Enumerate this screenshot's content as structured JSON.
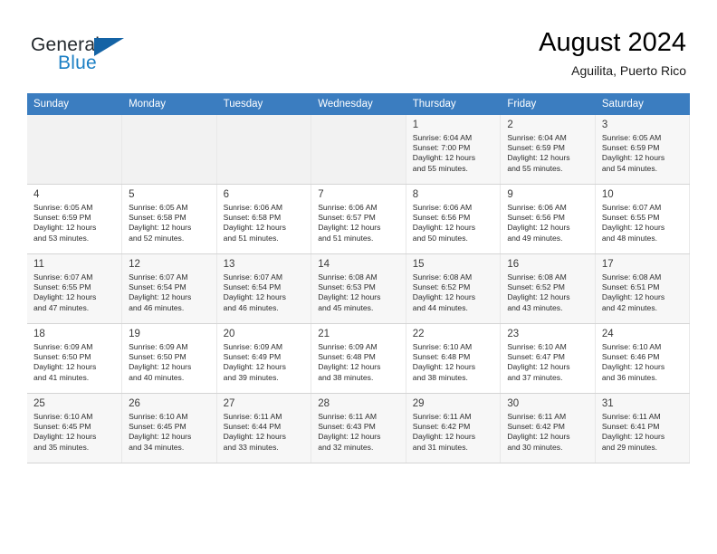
{
  "brand": {
    "name_part1": "General",
    "name_part2": "Blue",
    "flag_icon": "blue-triangle-flag-icon"
  },
  "header": {
    "title": "August 2024",
    "subtitle": "Aguilita, Puerto Rico"
  },
  "colors": {
    "header_row_bg": "#3b7dc0",
    "header_row_text": "#ffffff",
    "brand_blue": "#1b7fc4",
    "empty_cell_bg": "#f2f2f2",
    "shade_row_bg": "#f7f7f7",
    "grid_line": "#d4d4d4"
  },
  "labels": {
    "sunrise_prefix": "Sunrise:",
    "sunset_prefix": "Sunset:",
    "daylight_prefix": "Daylight:"
  },
  "weekday_headers": [
    "Sunday",
    "Monday",
    "Tuesday",
    "Wednesday",
    "Thursday",
    "Friday",
    "Saturday"
  ],
  "weeks": [
    [
      {
        "empty": true
      },
      {
        "empty": true
      },
      {
        "empty": true
      },
      {
        "empty": true
      },
      {
        "day": "1",
        "sunrise": "Sunrise: 6:04 AM",
        "sunset": "Sunset: 7:00 PM",
        "daylight_line1": "Daylight: 12 hours",
        "daylight_line2": "and 55 minutes."
      },
      {
        "day": "2",
        "sunrise": "Sunrise: 6:04 AM",
        "sunset": "Sunset: 6:59 PM",
        "daylight_line1": "Daylight: 12 hours",
        "daylight_line2": "and 55 minutes."
      },
      {
        "day": "3",
        "sunrise": "Sunrise: 6:05 AM",
        "sunset": "Sunset: 6:59 PM",
        "daylight_line1": "Daylight: 12 hours",
        "daylight_line2": "and 54 minutes."
      }
    ],
    [
      {
        "day": "4",
        "sunrise": "Sunrise: 6:05 AM",
        "sunset": "Sunset: 6:59 PM",
        "daylight_line1": "Daylight: 12 hours",
        "daylight_line2": "and 53 minutes."
      },
      {
        "day": "5",
        "sunrise": "Sunrise: 6:05 AM",
        "sunset": "Sunset: 6:58 PM",
        "daylight_line1": "Daylight: 12 hours",
        "daylight_line2": "and 52 minutes."
      },
      {
        "day": "6",
        "sunrise": "Sunrise: 6:06 AM",
        "sunset": "Sunset: 6:58 PM",
        "daylight_line1": "Daylight: 12 hours",
        "daylight_line2": "and 51 minutes."
      },
      {
        "day": "7",
        "sunrise": "Sunrise: 6:06 AM",
        "sunset": "Sunset: 6:57 PM",
        "daylight_line1": "Daylight: 12 hours",
        "daylight_line2": "and 51 minutes."
      },
      {
        "day": "8",
        "sunrise": "Sunrise: 6:06 AM",
        "sunset": "Sunset: 6:56 PM",
        "daylight_line1": "Daylight: 12 hours",
        "daylight_line2": "and 50 minutes."
      },
      {
        "day": "9",
        "sunrise": "Sunrise: 6:06 AM",
        "sunset": "Sunset: 6:56 PM",
        "daylight_line1": "Daylight: 12 hours",
        "daylight_line2": "and 49 minutes."
      },
      {
        "day": "10",
        "sunrise": "Sunrise: 6:07 AM",
        "sunset": "Sunset: 6:55 PM",
        "daylight_line1": "Daylight: 12 hours",
        "daylight_line2": "and 48 minutes."
      }
    ],
    [
      {
        "day": "11",
        "sunrise": "Sunrise: 6:07 AM",
        "sunset": "Sunset: 6:55 PM",
        "daylight_line1": "Daylight: 12 hours",
        "daylight_line2": "and 47 minutes."
      },
      {
        "day": "12",
        "sunrise": "Sunrise: 6:07 AM",
        "sunset": "Sunset: 6:54 PM",
        "daylight_line1": "Daylight: 12 hours",
        "daylight_line2": "and 46 minutes."
      },
      {
        "day": "13",
        "sunrise": "Sunrise: 6:07 AM",
        "sunset": "Sunset: 6:54 PM",
        "daylight_line1": "Daylight: 12 hours",
        "daylight_line2": "and 46 minutes."
      },
      {
        "day": "14",
        "sunrise": "Sunrise: 6:08 AM",
        "sunset": "Sunset: 6:53 PM",
        "daylight_line1": "Daylight: 12 hours",
        "daylight_line2": "and 45 minutes."
      },
      {
        "day": "15",
        "sunrise": "Sunrise: 6:08 AM",
        "sunset": "Sunset: 6:52 PM",
        "daylight_line1": "Daylight: 12 hours",
        "daylight_line2": "and 44 minutes."
      },
      {
        "day": "16",
        "sunrise": "Sunrise: 6:08 AM",
        "sunset": "Sunset: 6:52 PM",
        "daylight_line1": "Daylight: 12 hours",
        "daylight_line2": "and 43 minutes."
      },
      {
        "day": "17",
        "sunrise": "Sunrise: 6:08 AM",
        "sunset": "Sunset: 6:51 PM",
        "daylight_line1": "Daylight: 12 hours",
        "daylight_line2": "and 42 minutes."
      }
    ],
    [
      {
        "day": "18",
        "sunrise": "Sunrise: 6:09 AM",
        "sunset": "Sunset: 6:50 PM",
        "daylight_line1": "Daylight: 12 hours",
        "daylight_line2": "and 41 minutes."
      },
      {
        "day": "19",
        "sunrise": "Sunrise: 6:09 AM",
        "sunset": "Sunset: 6:50 PM",
        "daylight_line1": "Daylight: 12 hours",
        "daylight_line2": "and 40 minutes."
      },
      {
        "day": "20",
        "sunrise": "Sunrise: 6:09 AM",
        "sunset": "Sunset: 6:49 PM",
        "daylight_line1": "Daylight: 12 hours",
        "daylight_line2": "and 39 minutes."
      },
      {
        "day": "21",
        "sunrise": "Sunrise: 6:09 AM",
        "sunset": "Sunset: 6:48 PM",
        "daylight_line1": "Daylight: 12 hours",
        "daylight_line2": "and 38 minutes."
      },
      {
        "day": "22",
        "sunrise": "Sunrise: 6:10 AM",
        "sunset": "Sunset: 6:48 PM",
        "daylight_line1": "Daylight: 12 hours",
        "daylight_line2": "and 38 minutes."
      },
      {
        "day": "23",
        "sunrise": "Sunrise: 6:10 AM",
        "sunset": "Sunset: 6:47 PM",
        "daylight_line1": "Daylight: 12 hours",
        "daylight_line2": "and 37 minutes."
      },
      {
        "day": "24",
        "sunrise": "Sunrise: 6:10 AM",
        "sunset": "Sunset: 6:46 PM",
        "daylight_line1": "Daylight: 12 hours",
        "daylight_line2": "and 36 minutes."
      }
    ],
    [
      {
        "day": "25",
        "sunrise": "Sunrise: 6:10 AM",
        "sunset": "Sunset: 6:45 PM",
        "daylight_line1": "Daylight: 12 hours",
        "daylight_line2": "and 35 minutes."
      },
      {
        "day": "26",
        "sunrise": "Sunrise: 6:10 AM",
        "sunset": "Sunset: 6:45 PM",
        "daylight_line1": "Daylight: 12 hours",
        "daylight_line2": "and 34 minutes."
      },
      {
        "day": "27",
        "sunrise": "Sunrise: 6:11 AM",
        "sunset": "Sunset: 6:44 PM",
        "daylight_line1": "Daylight: 12 hours",
        "daylight_line2": "and 33 minutes."
      },
      {
        "day": "28",
        "sunrise": "Sunrise: 6:11 AM",
        "sunset": "Sunset: 6:43 PM",
        "daylight_line1": "Daylight: 12 hours",
        "daylight_line2": "and 32 minutes."
      },
      {
        "day": "29",
        "sunrise": "Sunrise: 6:11 AM",
        "sunset": "Sunset: 6:42 PM",
        "daylight_line1": "Daylight: 12 hours",
        "daylight_line2": "and 31 minutes."
      },
      {
        "day": "30",
        "sunrise": "Sunrise: 6:11 AM",
        "sunset": "Sunset: 6:42 PM",
        "daylight_line1": "Daylight: 12 hours",
        "daylight_line2": "and 30 minutes."
      },
      {
        "day": "31",
        "sunrise": "Sunrise: 6:11 AM",
        "sunset": "Sunset: 6:41 PM",
        "daylight_line1": "Daylight: 12 hours",
        "daylight_line2": "and 29 minutes."
      }
    ]
  ]
}
